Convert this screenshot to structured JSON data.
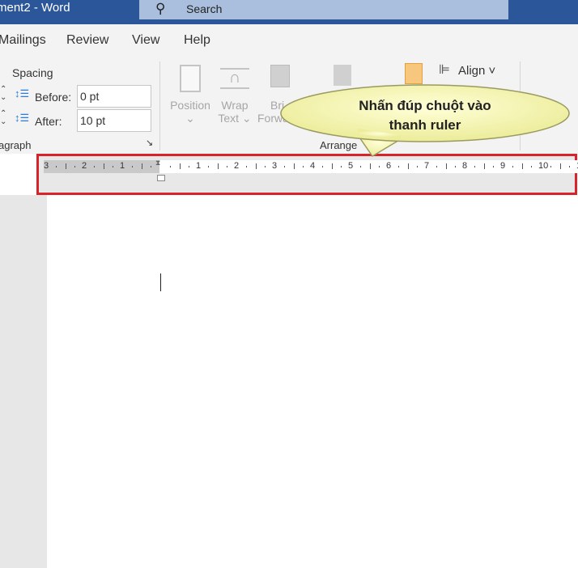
{
  "titlebar": {
    "title": "ment2  -  Word",
    "search_placeholder": "Search"
  },
  "tabs": [
    "Mailings",
    "Review",
    "View",
    "Help"
  ],
  "paragraph": {
    "spacing_label": "Spacing",
    "before_label": "Before:",
    "before_value": "0 pt",
    "after_label": "After:",
    "after_value": "10 pt",
    "group_label": "agraph"
  },
  "arrange": {
    "position": "Position",
    "wrap": "Wrap",
    "wrap2": "Text",
    "bring": "Bri",
    "bring2": "Forwa",
    "align": "Align",
    "group_label": "Arrange"
  },
  "ruler": {
    "labels": [
      "3",
      "2",
      "1",
      "1",
      "2",
      "3",
      "4",
      "5",
      "6",
      "7",
      "8",
      "9",
      "10",
      "1"
    ]
  },
  "callout": {
    "line1": "Nhấn đúp chuột vào",
    "line2": "thanh ruler",
    "accent": "#d9232b"
  }
}
